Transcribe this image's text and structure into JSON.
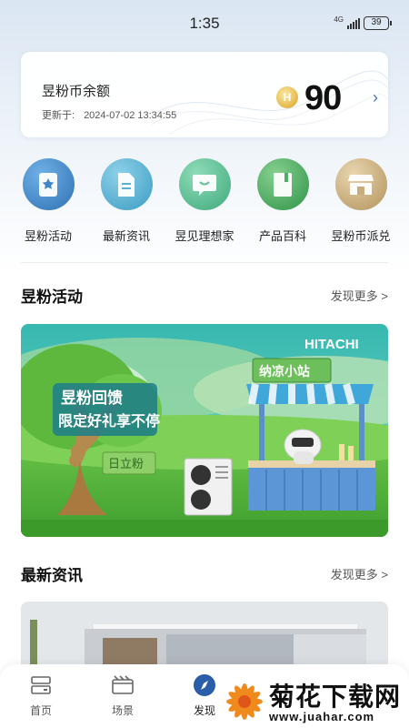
{
  "status_bar": {
    "time": "1:35",
    "network": "4G",
    "battery": "39"
  },
  "balance": {
    "title": "昱粉币余额",
    "updated_label": "更新于:",
    "updated_time": "2024-07-02 13:34:55",
    "coin_glyph": "H",
    "value": "90",
    "arrow": "›"
  },
  "nav": [
    {
      "label": "昱粉活动",
      "icon": "star-bookmark-icon",
      "color": "#3f86c4"
    },
    {
      "label": "最新资讯",
      "icon": "document-icon",
      "color": "#5ab0d0"
    },
    {
      "label": "昱见理想家",
      "icon": "chat-bubble-icon",
      "color": "#5fbf96"
    },
    {
      "label": "产品百科",
      "icon": "book-icon",
      "color": "#4fae63"
    },
    {
      "label": "昱粉币派兑",
      "icon": "store-icon",
      "color": "#c8ad7c"
    }
  ],
  "activities": {
    "title": "昱粉活动",
    "more": "发现更多 >",
    "banner": {
      "brand": "HITACHI",
      "line1": "昱粉回馈",
      "line2": "限定好礼享不停",
      "shop_sign": "纳凉小站",
      "tree_sign": "日立粉"
    }
  },
  "news": {
    "title": "最新资讯",
    "more": "发现更多 >"
  },
  "tabs": [
    {
      "label": "首页",
      "icon": "home-icon"
    },
    {
      "label": "场景",
      "icon": "scene-icon"
    },
    {
      "label": "发现",
      "icon": "compass-icon",
      "active": true
    }
  ],
  "watermark": {
    "title": "菊花下载网",
    "url": "www.juahar.com"
  }
}
